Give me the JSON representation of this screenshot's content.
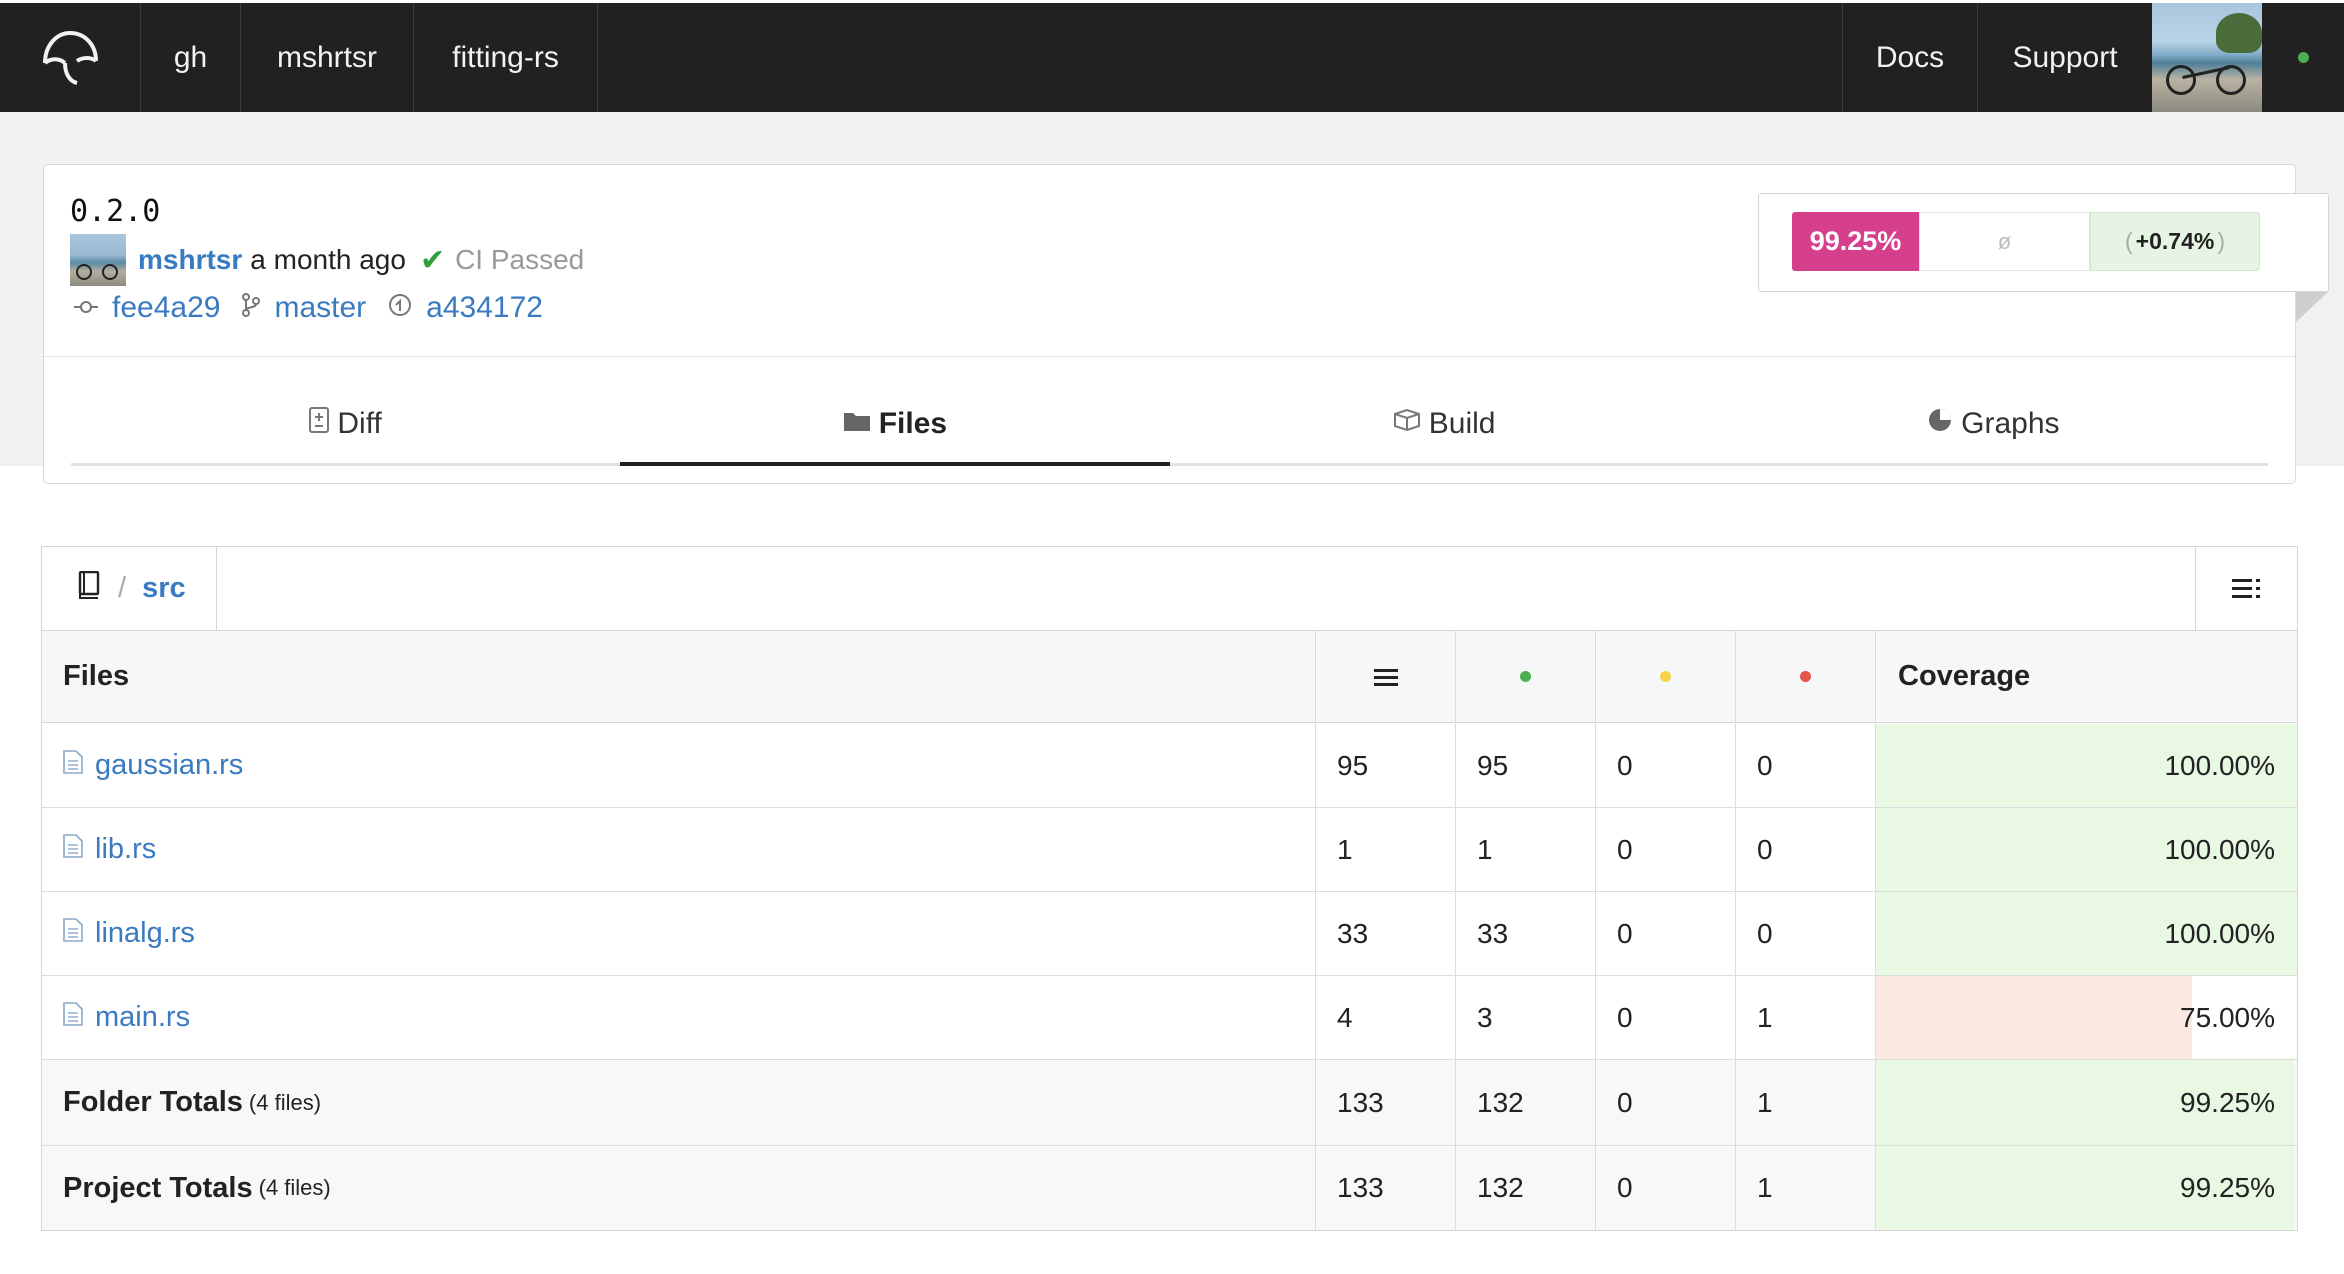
{
  "nav": {
    "owner_service": "gh",
    "owner": "mshrtsr",
    "repo": "fitting-rs",
    "docs": "Docs",
    "support": "Support",
    "status_color": "#4caf50"
  },
  "commit": {
    "title": "0.2.0",
    "author": "mshrtsr",
    "time": "a month ago",
    "ci_status": "CI Passed",
    "commit_sha": "fee4a29",
    "branch": "master",
    "parent_sha": "a434172"
  },
  "coverage_summary": {
    "coverage": "99.25%",
    "base": "ø",
    "change": "+0.74%",
    "paren_open": "(",
    "paren_close": ")",
    "accent_color": "#d53f8c"
  },
  "tabs": [
    {
      "label": "Diff",
      "icon": "diff-icon",
      "active": false
    },
    {
      "label": "Files",
      "icon": "folder-icon",
      "active": true
    },
    {
      "label": "Build",
      "icon": "build-icon",
      "active": false
    },
    {
      "label": "Graphs",
      "icon": "pie-chart-icon",
      "active": false
    }
  ],
  "breadcrumb": {
    "separator": "/",
    "folder": "src"
  },
  "table": {
    "header": {
      "files": "Files",
      "coverage": "Coverage",
      "hits_color": "#4caf50",
      "partial_color": "#f5d547",
      "missed_color": "#e5534b"
    },
    "rows": [
      {
        "name": "gaussian.rs",
        "lines": "95",
        "hits": "95",
        "partials": "0",
        "misses": "0",
        "coverage": "100.00%",
        "coverage_value": 100
      },
      {
        "name": "lib.rs",
        "lines": "1",
        "hits": "1",
        "partials": "0",
        "misses": "0",
        "coverage": "100.00%",
        "coverage_value": 100
      },
      {
        "name": "linalg.rs",
        "lines": "33",
        "hits": "33",
        "partials": "0",
        "misses": "0",
        "coverage": "100.00%",
        "coverage_value": 100
      },
      {
        "name": "main.rs",
        "lines": "4",
        "hits": "3",
        "partials": "0",
        "misses": "1",
        "coverage": "75.00%",
        "coverage_value": 75
      }
    ],
    "folder_totals": {
      "label": "Folder Totals",
      "sub": "(4 files)",
      "lines": "133",
      "hits": "132",
      "partials": "0",
      "misses": "1",
      "coverage": "99.25%",
      "coverage_value": 99.25
    },
    "project_totals": {
      "label": "Project Totals",
      "sub": "(4 files)",
      "lines": "133",
      "hits": "132",
      "partials": "0",
      "misses": "1",
      "coverage": "99.25%",
      "coverage_value": 99.25
    }
  }
}
